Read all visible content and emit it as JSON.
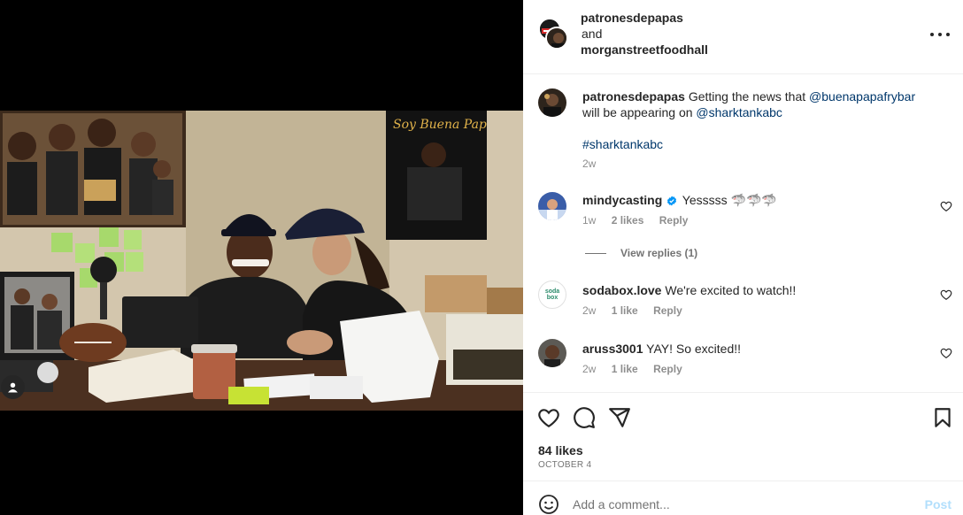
{
  "header": {
    "author_1": "patronesdepapas",
    "conjunction": "and",
    "author_2": "morganstreetfoodhall"
  },
  "caption": {
    "username": "patronesdepapas",
    "text_1": "Getting the news that",
    "mention_1": "@buenapapafrybar",
    "text_2": "will be appearing on",
    "mention_2": "@sharktankabc",
    "hashtag": "#sharktankabc",
    "time": "2w"
  },
  "comments": [
    {
      "username": "mindycasting",
      "verified": true,
      "text": "Yesssss 🦈🦈🦈",
      "time": "1w",
      "likes": "2 likes",
      "reply": "Reply"
    },
    {
      "username": "sodabox.love",
      "verified": false,
      "text": "We're excited to watch!!",
      "time": "2w",
      "likes": "1 like",
      "reply": "Reply"
    },
    {
      "username": "aruss3001",
      "verified": false,
      "text": "YAY! So excited!!",
      "time": "2w",
      "likes": "1 like",
      "reply": "Reply"
    }
  ],
  "view_replies": "View replies (1)",
  "soda_logo_text": "soda box",
  "likes_count": "84 likes",
  "post_date": "OCTOBER 4",
  "comment_box": {
    "placeholder": "Add a comment...",
    "post_label": "Post"
  },
  "icons": {
    "like": "heart-icon",
    "comment": "comment-icon",
    "share": "share-icon",
    "save": "bookmark-icon",
    "emoji": "emoji-icon",
    "more": "more-icon",
    "tag": "user-tag-icon"
  },
  "colors": {
    "link": "#00376b",
    "verified": "#0095f6",
    "post_disabled": "#b2dffc",
    "meta": "#8e8e8e"
  }
}
